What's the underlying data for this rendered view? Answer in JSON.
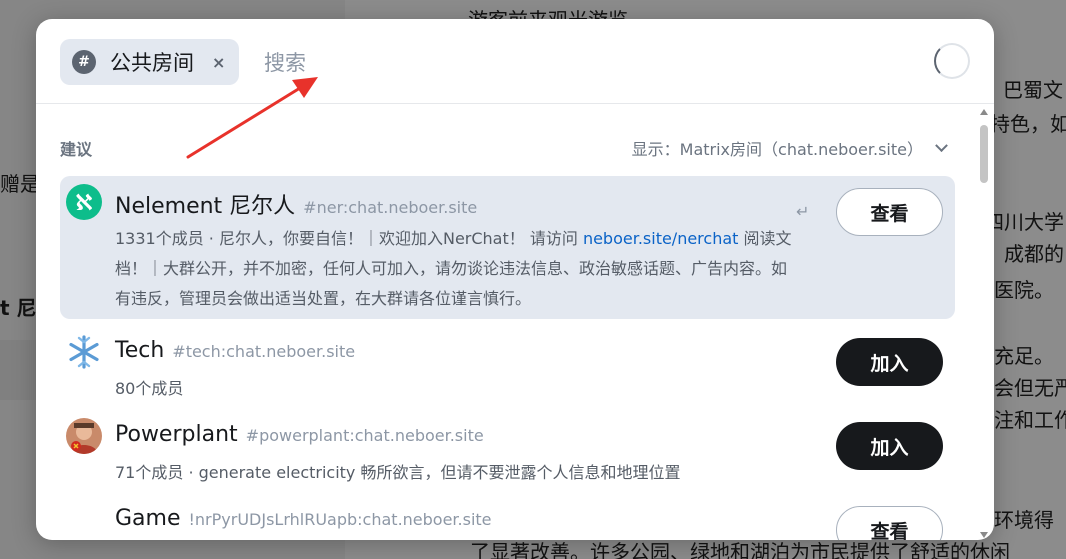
{
  "background": {
    "texts": [
      "游客前来观光游览",
      "巴蜀文",
      "持色，如",
      "赠是",
      "t 尼",
      "四川大学",
      "成都的",
      "医院。",
      "充足。",
      "会但无严",
      "注和工作",
      "环境得",
      "了显著改善。许多公园、绿地和湖泊为市民提供了舒适的休闲"
    ]
  },
  "search": {
    "chip_label": "公共房间",
    "chip_remove": "×",
    "hash_glyph": "#",
    "placeholder": "搜索"
  },
  "suggestions": {
    "header": "建议",
    "filter_label": "显示：Matrix房间（chat.neboer.site）"
  },
  "rooms": [
    {
      "name": "Nelement 尼尔人",
      "alias": "#ner:chat.neboer.site",
      "desc_before_link": "1331个成员 · 尼尔人，你要自信！｜欢迎加入NerChat！ 请访问 ",
      "desc_link": "neboer.site/nerchat",
      "desc_after_link": " 阅读文档！｜大群公开，并不加密，任何人可加入，请勿谈论违法信息、政治敏感话题、广告内容。如有违反，管理员会做出适当处置，在大群请各位谨言慎行。",
      "enter_hint": "↵",
      "action": "查看",
      "avatar_glyph": "ℵ"
    },
    {
      "name": "Tech",
      "alias": "#tech:chat.neboer.site",
      "desc": "80个成员",
      "action": "加入"
    },
    {
      "name": "Powerplant",
      "alias": "#powerplant:chat.neboer.site",
      "desc": "71个成员 · generate electricity 畅所欲言，但请不要泄露个人信息和地理位置",
      "action": "加入"
    },
    {
      "name": "Game",
      "alias": "!nrPyrUDJsLrhlRUapb:chat.neboer.site",
      "desc": "",
      "action": "查看"
    }
  ],
  "colors": {
    "accent_dark": "#17191c",
    "row_highlight": "#e3e8f0",
    "link": "#0b63c7",
    "annotation_arrow": "#e8322b"
  }
}
